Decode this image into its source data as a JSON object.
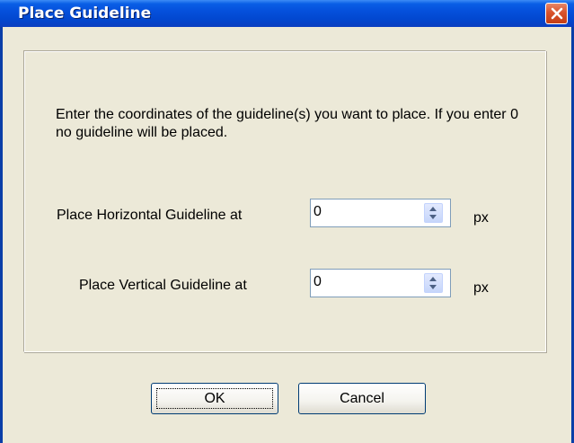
{
  "window": {
    "title": "Place Guideline"
  },
  "dialog": {
    "description": "Enter the coordinates of the guideline(s) you want to place. If you enter 0 no guideline will be placed.",
    "horizontal": {
      "label": "Place Horizontal Guideline at",
      "value": "0",
      "unit": "px"
    },
    "vertical": {
      "label": "Place Vertical Guideline at",
      "value": "0",
      "unit": "px"
    },
    "ok_label": "OK",
    "cancel_label": "Cancel"
  },
  "icons": {
    "close": "close-icon",
    "spin_up": "spin-up-icon",
    "spin_down": "spin-down-icon"
  },
  "colors": {
    "titlebar": "#0550dc",
    "dialog_background": "#ece9d8",
    "close_button": "#d9532c"
  }
}
